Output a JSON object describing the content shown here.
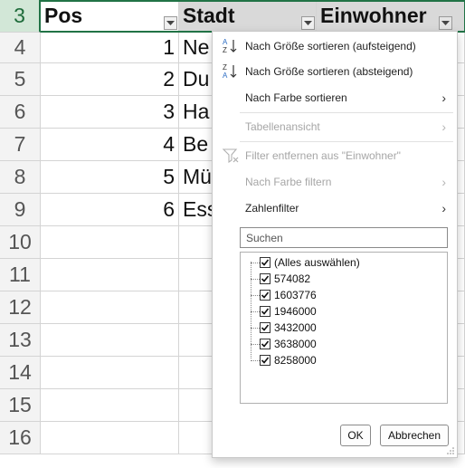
{
  "sheet": {
    "header_row_num": "3",
    "headers": {
      "a": "Pos",
      "b": "Stadt",
      "c": "Einwohner"
    },
    "rows": [
      {
        "num": "4",
        "pos": "1",
        "stadt": "Ne"
      },
      {
        "num": "5",
        "pos": "2",
        "stadt": "Du"
      },
      {
        "num": "6",
        "pos": "3",
        "stadt": "Ha"
      },
      {
        "num": "7",
        "pos": "4",
        "stadt": "Be"
      },
      {
        "num": "8",
        "pos": "5",
        "stadt": "Mü"
      },
      {
        "num": "9",
        "pos": "6",
        "stadt": "Ess"
      },
      {
        "num": "10",
        "pos": "",
        "stadt": ""
      },
      {
        "num": "11",
        "pos": "",
        "stadt": ""
      },
      {
        "num": "12",
        "pos": "",
        "stadt": ""
      },
      {
        "num": "13",
        "pos": "",
        "stadt": ""
      },
      {
        "num": "14",
        "pos": "",
        "stadt": ""
      },
      {
        "num": "15",
        "pos": "",
        "stadt": ""
      },
      {
        "num": "16",
        "pos": "",
        "stadt": ""
      }
    ]
  },
  "filter_menu": {
    "sort_asc": "Nach Größe sortieren (aufsteigend)",
    "sort_desc": "Nach Größe sortieren (absteigend)",
    "sort_by_color": "Nach Farbe sortieren",
    "table_view": "Tabellenansicht",
    "remove_filter": "Filter entfernen aus \"Einwohner\"",
    "filter_by_color": "Nach Farbe filtern",
    "number_filter": "Zahlenfilter",
    "search_placeholder": "Suchen",
    "values": [
      {
        "label": "(Alles auswählen)",
        "checked": true
      },
      {
        "label": "574082",
        "checked": true
      },
      {
        "label": "1603776",
        "checked": true
      },
      {
        "label": "1946000",
        "checked": true
      },
      {
        "label": "3432000",
        "checked": true
      },
      {
        "label": "3638000",
        "checked": true
      },
      {
        "label": "8258000",
        "checked": true
      }
    ],
    "ok_label": "OK",
    "cancel_label": "Abbrechen"
  },
  "icons": {
    "sort_asc": "sort-ascending-icon",
    "sort_desc": "sort-descending-icon",
    "filter_remove": "filter-clear-icon",
    "dropdown": "dropdown-arrow-icon",
    "submenu": "chevron-right-icon"
  },
  "colors": {
    "excel_green": "#217346",
    "header_fill": "#d9d9d9",
    "sort_icon_blue": "#2b6cc4"
  }
}
